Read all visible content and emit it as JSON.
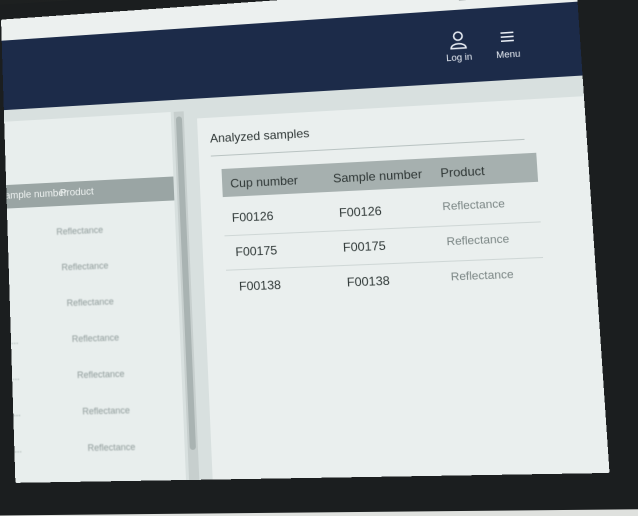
{
  "window": {
    "controls": [
      "–",
      "□",
      "×"
    ]
  },
  "header": {
    "login_label": "Log in",
    "menu_label": "Menu",
    "icons": [
      "user-icon",
      "hamburger-icon"
    ]
  },
  "left_panel": {
    "columns": [
      "...ample number",
      "Product"
    ],
    "rows": [
      {
        "sample": "",
        "product": "Reflectance"
      },
      {
        "sample": "",
        "product": "Reflectance"
      },
      {
        "sample": "",
        "product": "Reflectance"
      },
      {
        "sample": "...",
        "product": "Reflectance"
      },
      {
        "sample": "...",
        "product": "Reflectance"
      },
      {
        "sample": "...",
        "product": "Reflectance"
      },
      {
        "sample": "...",
        "product": "Reflectance"
      }
    ]
  },
  "analyzed": {
    "title": "Analyzed samples",
    "columns": [
      "Cup number",
      "Sample number",
      "Product"
    ],
    "rows": [
      {
        "cup": "F00126",
        "sample": "F00126",
        "product": "Reflectance"
      },
      {
        "cup": "F00175",
        "sample": "F00175",
        "product": "Reflectance"
      },
      {
        "cup": "F00138",
        "sample": "F00138",
        "product": "Reflectance"
      }
    ]
  },
  "colors": {
    "appbar": "#1c2b49",
    "table_header": "#a6b0af"
  }
}
